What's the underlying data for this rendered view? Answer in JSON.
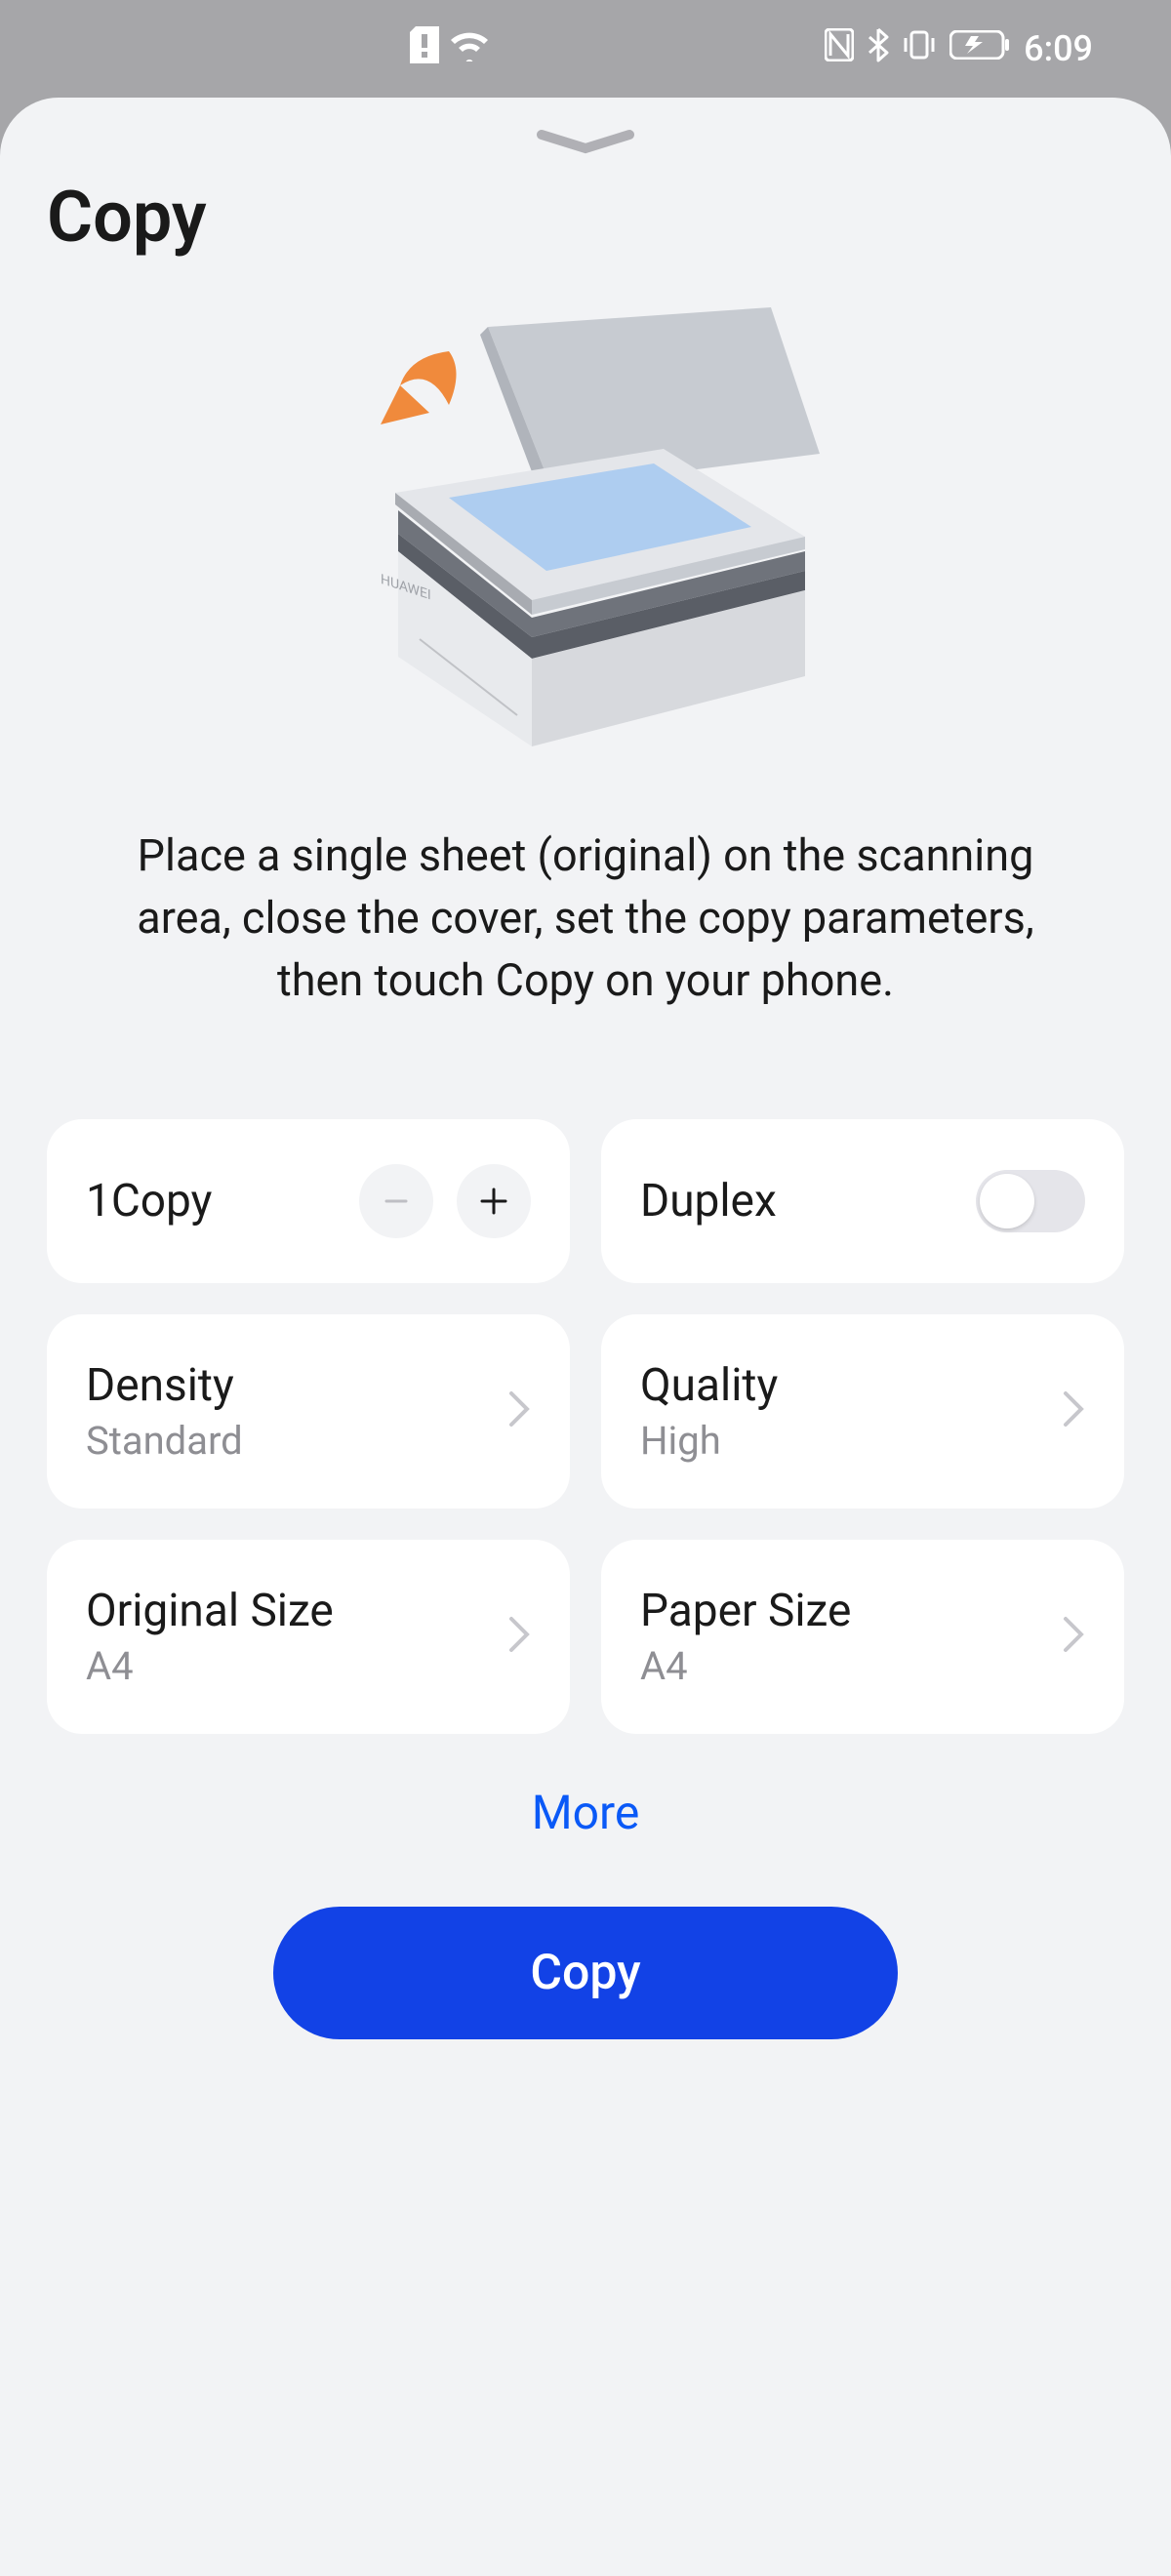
{
  "status": {
    "time": "6:09"
  },
  "page": {
    "title": "Copy",
    "instruction": "Place a single sheet (original) on the scanning area, close the cover, set the copy parameters, then touch Copy on your phone."
  },
  "cards": {
    "copies": {
      "label": "1Copy"
    },
    "duplex": {
      "label": "Duplex",
      "on": false
    },
    "density": {
      "label": "Density",
      "value": "Standard"
    },
    "quality": {
      "label": "Quality",
      "value": "High"
    },
    "original_size": {
      "label": "Original Size",
      "value": "A4"
    },
    "paper_size": {
      "label": "Paper Size",
      "value": "A4"
    }
  },
  "actions": {
    "more": "More",
    "copy_button": "Copy"
  }
}
